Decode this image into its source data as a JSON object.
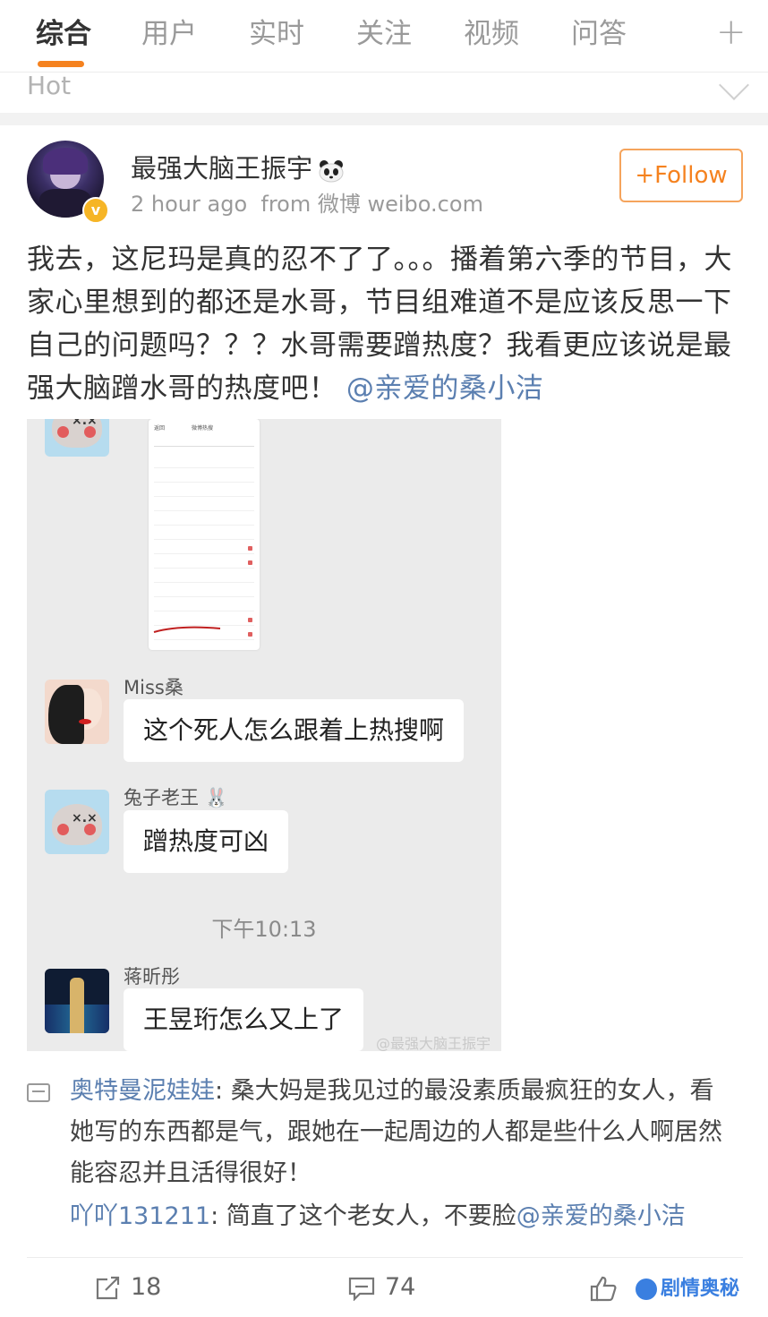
{
  "tabs": [
    {
      "label": "综合",
      "active": true
    },
    {
      "label": "用户",
      "active": false
    },
    {
      "label": "实时",
      "active": false
    },
    {
      "label": "关注",
      "active": false
    },
    {
      "label": "视频",
      "active": false
    },
    {
      "label": "问答",
      "active": false
    }
  ],
  "add_tab_symbol": "+",
  "hot_label": "Hot",
  "post": {
    "username": "最强大脑王振宇",
    "username_emoji": "panda",
    "verified_badge": "v",
    "time": "2 hour ago",
    "source": "from 微博 weibo.com",
    "follow_label": "+Follow",
    "text": "我去，这尼玛是真的忍不了了。。。播着第六季的节目，大家心里想到的都还是水哥，节目组难道不是应该反思一下自己的问题吗？？？水哥需要蹭热度？我看更应该说是最强大脑蹭水哥的热度吧！",
    "mention": "@亲爱的桑小洁"
  },
  "chat_image": {
    "messages": [
      {
        "sender": "Miss桑",
        "text": "这个死人怎么跟着上热搜啊"
      },
      {
        "sender": "兔子老王",
        "text": "蹭热度可凶"
      },
      {
        "sender": "蒋昕彤",
        "text": "王昱珩怎么又上了"
      }
    ],
    "sender_emoji_rabbit": "🐰",
    "timestamp": "下午10:13",
    "watermark": "@最强大脑王振宇",
    "screenshot_title": "微博热搜",
    "screenshot_back": "返回"
  },
  "comments": [
    {
      "user": "奥特曼泥娃娃",
      "text": "桑大妈是我见过的最没素质最疯狂的女人，看她写的东西都是气，跟她在一起周边的人都是些什么人啊居然能容忍并且活得很好！"
    },
    {
      "user": "吖吖131211",
      "text": "简直了这个老女人，不要脸",
      "mention": "@亲爱的桑小洁"
    }
  ],
  "actions": {
    "repost_count": "18",
    "comment_count": "74"
  },
  "brand_watermark": "剧情奥秘",
  "colors": {
    "accent": "#f5821f",
    "link": "#5b7fb0",
    "brand": "#3a7fe0"
  }
}
